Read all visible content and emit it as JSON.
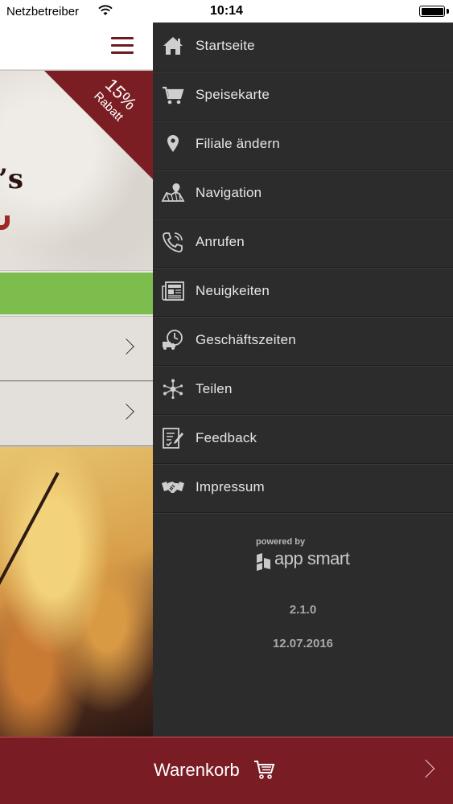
{
  "status_bar": {
    "carrier": "Netzbetreiber",
    "time": "10:14",
    "wifi_icon": "wifi-icon",
    "battery_icon": "battery-icon"
  },
  "background_page": {
    "menu_icon": "hamburger-menu-icon",
    "discount": {
      "percent": "15%",
      "label": "Rabatt"
    },
    "brand_fragment": "’s",
    "row_chevron_icon": "chevron-right-icon"
  },
  "drawer": {
    "items": [
      {
        "label": "Startseite",
        "icon": "home-icon"
      },
      {
        "label": "Speisekarte",
        "icon": "cart-icon"
      },
      {
        "label": "Filiale ändern",
        "icon": "location-pin-icon"
      },
      {
        "label": "Navigation",
        "icon": "map-icon"
      },
      {
        "label": "Anrufen",
        "icon": "phone-icon"
      },
      {
        "label": "Neuigkeiten",
        "icon": "newspaper-icon"
      },
      {
        "label": "Geschäftszeiten",
        "icon": "delivery-clock-icon"
      },
      {
        "label": "Teilen",
        "icon": "share-icon"
      },
      {
        "label": "Feedback",
        "icon": "feedback-icon"
      },
      {
        "label": "Impressum",
        "icon": "handshake-icon"
      }
    ],
    "powered_by": "powered by",
    "brand": "app smart",
    "version": "2.1.0",
    "date": "12.07.2016"
  },
  "cart_bar": {
    "label": "Warenkorb",
    "icon": "shopping-cart-icon",
    "chevron": "chevron-right-icon"
  },
  "colors": {
    "accent": "#7a1c24",
    "drawer_bg": "#2c2c2c",
    "green_bar": "#7cbd4d"
  }
}
